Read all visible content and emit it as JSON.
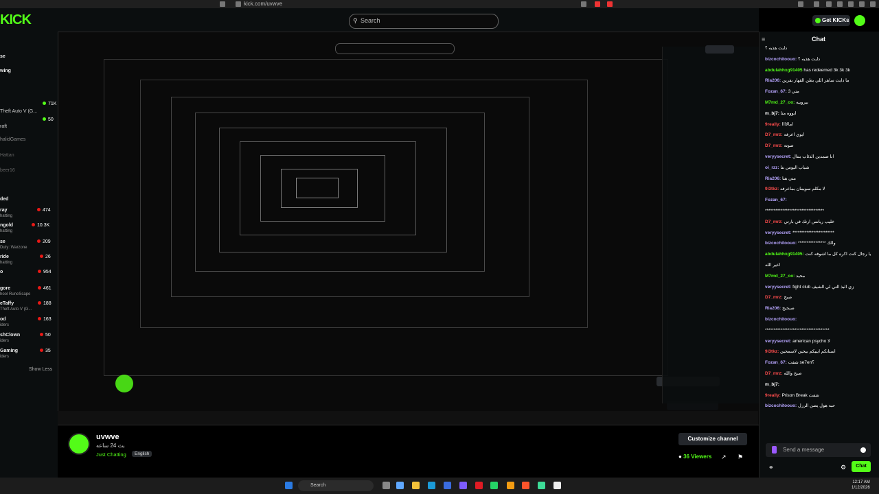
{
  "browser": {
    "url": "kick.com/uvwve"
  },
  "header": {
    "logo": "KICK",
    "search_placeholder": "Search",
    "get_kicks": "Get KICKs"
  },
  "sidebar": {
    "items": [
      {
        "label": "se"
      },
      {
        "label": "wing"
      }
    ],
    "channels": [
      {
        "name": "Theft Auto V (G...",
        "viewers": "71K"
      },
      {
        "name": "raft",
        "viewers": "50"
      },
      {
        "name": "halidGames",
        "viewers": ""
      },
      {
        "name": "Hattan",
        "viewers": ""
      },
      {
        "name": "beer16",
        "viewers": ""
      }
    ],
    "section_title": "ded",
    "live": [
      {
        "name": "ray",
        "sub": "hatting",
        "viewers": "474"
      },
      {
        "name": "ngold",
        "sub": "hatting",
        "viewers": "10.3K"
      },
      {
        "name": "se",
        "sub": "Duty: Warzone",
        "viewers": "209"
      },
      {
        "name": "ride",
        "sub": "hatting",
        "viewers": "26"
      },
      {
        "name": "o",
        "sub": "",
        "viewers": "954"
      },
      {
        "name": "gore",
        "sub": "hool RuneScape",
        "viewers": "461"
      },
      {
        "name": "eTaffy",
        "sub": "Theft Auto V (G...",
        "viewers": "188"
      },
      {
        "name": "od",
        "sub": "iders",
        "viewers": "163"
      },
      {
        "name": "shClown",
        "sub": "iders",
        "viewers": "50"
      },
      {
        "name": "Gaming",
        "sub": "iders",
        "viewers": "35"
      }
    ],
    "show_less": "Show Less"
  },
  "chat": {
    "title": "Chat",
    "messages": [
      {
        "user": "",
        "text": "دايت هذيه ؟",
        "color": "#ffffff"
      },
      {
        "user": "bizcochitoouo:",
        "text": "دايت هذيه ؟",
        "color": "#b8a6ff"
      },
      {
        "user": "abdulahhxg91405",
        "text": "has redeemed 3k 3k 3k",
        "color": "#53fc18"
      },
      {
        "user": "Ria206:",
        "text": "ما دايت ساهر اللي بطن القهار بفرين",
        "color": "#b8a6ff"
      },
      {
        "user": "Fozan_67:",
        "text": "متي 3",
        "color": "#b8a6ff"
      },
      {
        "user": "M7md_27_oo:",
        "text": "بيروبيه",
        "color": "#53fc18"
      },
      {
        "user": "m_bj7:",
        "text": "ابووه متا",
        "color": "#ffffff"
      },
      {
        "user": "9really:",
        "text": "امالاااا",
        "color": "#ff4d4d"
      },
      {
        "user": "D7_mrz:",
        "text": "ابوي اعرفه",
        "color": "#ff4d4d"
      },
      {
        "user": "D7_mrz:",
        "text": "صوته",
        "color": "#ff4d4d"
      },
      {
        "user": "veryysecret:",
        "text": "انا صمدين الذئاب بنتال",
        "color": "#b8a6ff"
      },
      {
        "user": "oi_rzz:",
        "text": "شباب اليوس نتا",
        "color": "#b8a6ff"
      },
      {
        "user": "Ria206:",
        "text": "متي هنا",
        "color": "#b8a6ff"
      },
      {
        "user": "9i3tkz:",
        "text": "لا مكلم سويمان بماعرفه",
        "color": "#ff4d4d"
      },
      {
        "user": "Fozan_67:",
        "text": "",
        "color": "#b8a6ff"
      },
      {
        "user": "",
        "text": "**********************************",
        "color": "#ffffff"
      },
      {
        "user": "D7_mrz:",
        "text": "خليب ريانس ارتك في بارتي",
        "color": "#ff4d4d"
      },
      {
        "user": "veryysecret:",
        "text": "************************",
        "color": "#b8a6ff"
      },
      {
        "user": "bizcochitoouo:",
        "text": "**************** والك",
        "color": "#b8a6ff"
      },
      {
        "user": "abdulahhxg91405:",
        "text": "يا رجال كنت اكره كل ما اشوفه كنت",
        "color": "#53fc18"
      },
      {
        "user": "",
        "text": "اعير الله",
        "color": "#ffffff"
      },
      {
        "user": "M7md_27_oo:",
        "text": "محيد",
        "color": "#53fc18"
      },
      {
        "user": "veryysecret:",
        "text": "fight club زي البذ التي لي الشيف",
        "color": "#b8a6ff"
      },
      {
        "user": "D7_mrz:",
        "text": "صبح",
        "color": "#ff4d4d"
      },
      {
        "user": "Ria206:",
        "text": "صبحيح",
        "color": "#b8a6ff"
      },
      {
        "user": "bizcochitoouo:",
        "text": "",
        "color": "#b8a6ff"
      },
      {
        "user": "",
        "text": "*************************************",
        "color": "#ffffff"
      },
      {
        "user": "veryysecret:",
        "text": "american psycho لا",
        "color": "#b8a6ff"
      },
      {
        "user": "9i3tkz:",
        "text": "استانكم ايبيكم بيحين لاسمحين",
        "color": "#ff4d4d"
      },
      {
        "user": "Fozan_67:",
        "text": "شفت se7en؟",
        "color": "#b8a6ff"
      },
      {
        "user": "D7_mrz:",
        "text": "صبح والله",
        "color": "#ff4d4d"
      },
      {
        "user": "m_bj7:",
        "text": "",
        "color": "#ffffff"
      },
      {
        "user": "9really:",
        "text": "Prison Break شفت",
        "color": "#ff4d4d"
      },
      {
        "user": "bizcochitoouo:",
        "text": "حبه هول يصن الزرل",
        "color": "#b8a6ff"
      }
    ],
    "send_placeholder": "Send a message",
    "chat_button": "Chat"
  },
  "channel": {
    "name": "uvwve",
    "subtitle": "بث 24 ساعه",
    "category": "Just Chatting",
    "language": "English",
    "customize_label": "Customize channel",
    "viewers_count": "36",
    "viewers_label": "Viewers"
  },
  "taskbar": {
    "search_placeholder": "Search",
    "time": "12:17 AM",
    "date": "1/12/2026"
  },
  "colors": {
    "accent": "#53fc18",
    "bg": "#0b0e0f"
  }
}
